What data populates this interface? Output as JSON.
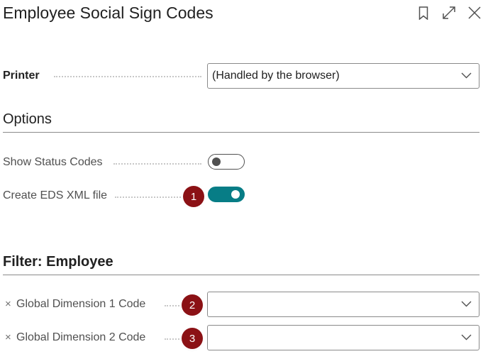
{
  "header": {
    "title": "Employee Social Sign Codes",
    "icons": [
      "bookmark-icon",
      "expand-icon",
      "close-icon"
    ]
  },
  "printer": {
    "label": "Printer",
    "value": "(Handled by the browser)"
  },
  "options": {
    "title": "Options",
    "show_status_codes": {
      "label": "Show Status Codes",
      "enabled": false
    },
    "create_eds_xml": {
      "label": "Create EDS XML file",
      "enabled": true
    }
  },
  "filter": {
    "title": "Filter: Employee",
    "fields": [
      {
        "label": "Global Dimension 1 Code",
        "value": "",
        "remove_icon": "×"
      },
      {
        "label": "Global Dimension 2 Code",
        "value": "",
        "remove_icon": "×"
      }
    ]
  },
  "badges": [
    "1",
    "2",
    "3"
  ],
  "colors": {
    "accent": "#077d86",
    "badge": "#8b1115",
    "text": "#212121",
    "muted": "#505050"
  }
}
